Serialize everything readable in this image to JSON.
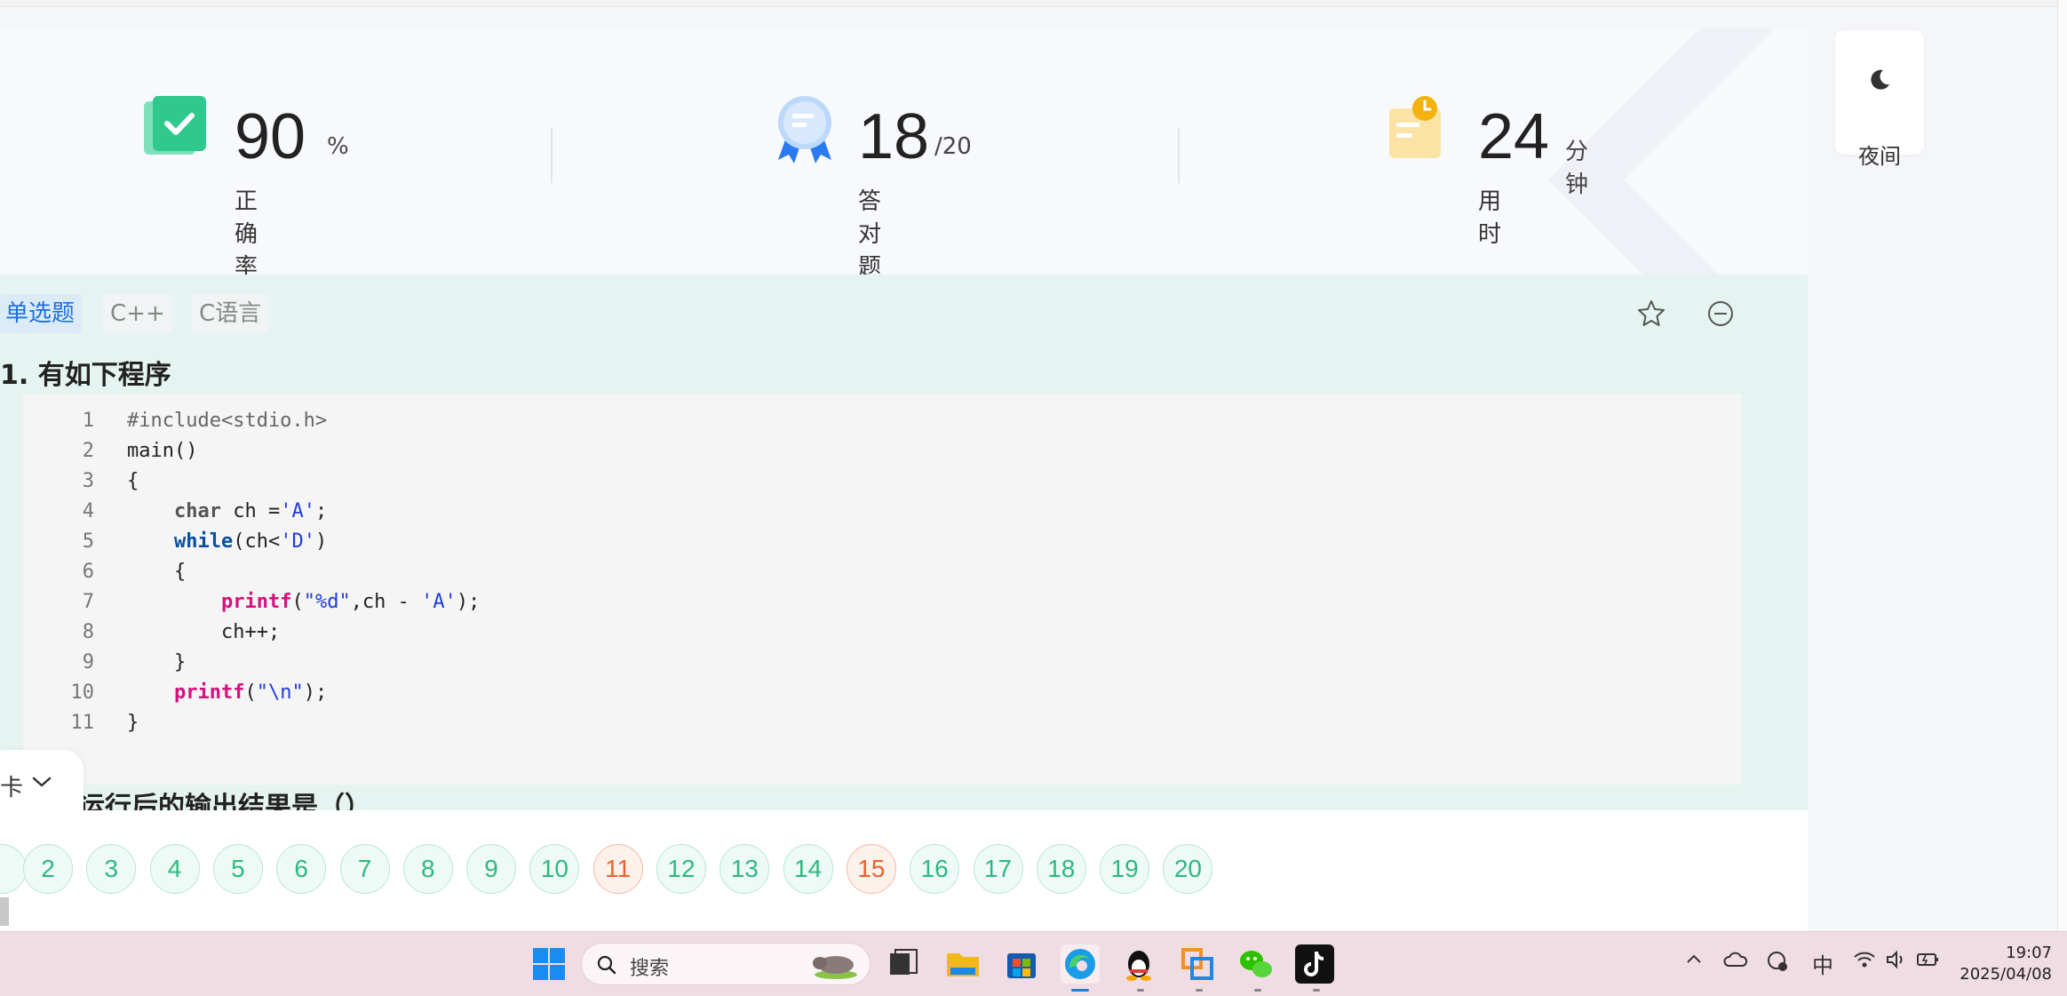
{
  "stats": [
    {
      "value": "90",
      "unit": "%",
      "label": "正确率"
    },
    {
      "value": "18",
      "unit": "/20",
      "label": "答对题目数"
    },
    {
      "value": "24",
      "unit": "分钟",
      "label": "用时"
    }
  ],
  "night_mode": {
    "label": "夜间"
  },
  "question": {
    "tags": [
      "单选题",
      "C++",
      "C语言"
    ],
    "title": "1. 有如下程序",
    "sub_text": "运行后的输出结果是（）",
    "code_line_numbers": [
      "1",
      "2",
      "3",
      "4",
      "5",
      "6",
      "7",
      "8",
      "9",
      "10",
      "11"
    ]
  },
  "answer_card": {
    "label": "卡"
  },
  "numbers": {
    "items": [
      "2",
      "3",
      "4",
      "5",
      "6",
      "7",
      "8",
      "9",
      "10",
      "11",
      "12",
      "13",
      "14",
      "15",
      "16",
      "17",
      "18",
      "19",
      "20"
    ],
    "wrong": [
      "11",
      "15"
    ]
  },
  "taskbar": {
    "search_placeholder": "搜索",
    "ime": "中",
    "time": "19:07",
    "date": "2025/04/08"
  },
  "colors": {
    "accent_green": "#2fb883",
    "wrong_orange": "#e8622f",
    "tag_blue": "#1f6fe0"
  }
}
